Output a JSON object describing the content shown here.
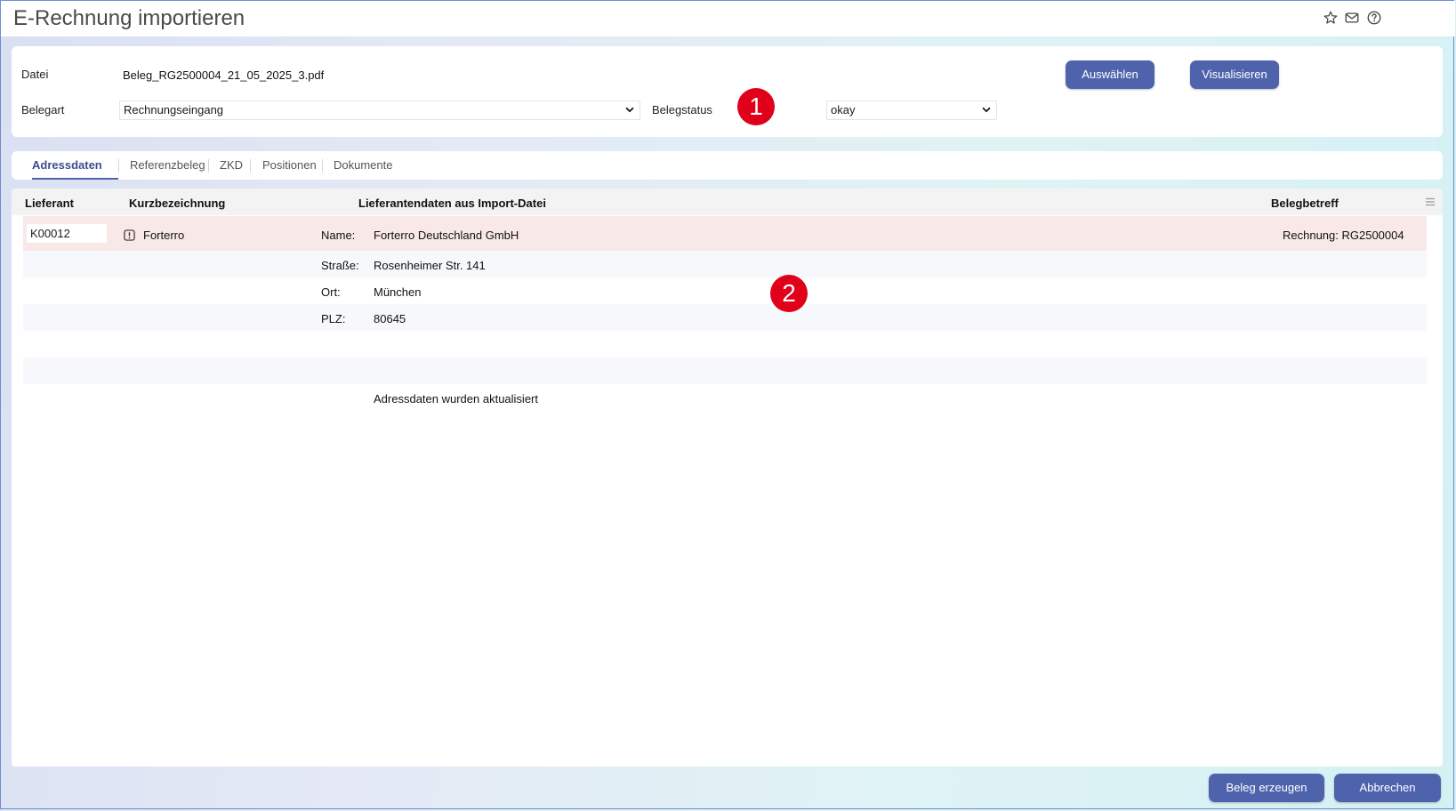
{
  "window": {
    "title": "E-Rechnung importieren",
    "icons": [
      "star-icon",
      "mail-icon",
      "help-icon"
    ]
  },
  "header": {
    "datei_label": "Datei",
    "datei_value": "Beleg_RG2500004_21_05_2025_3.pdf",
    "belegart_label": "Belegart",
    "belegart_value": "Rechnungseingang",
    "belegstatus_label": "Belegstatus",
    "belegstatus_value": "okay",
    "auswaehlen_label": "Auswählen",
    "visualisieren_label": "Visualisieren"
  },
  "markers": [
    "1",
    "2"
  ],
  "tabs": [
    {
      "label": "Adressdaten",
      "active": true
    },
    {
      "label": "Referenzbeleg",
      "active": false
    },
    {
      "label": "ZKD",
      "active": false
    },
    {
      "label": "Positionen",
      "active": false
    },
    {
      "label": "Dokumente",
      "active": false
    }
  ],
  "grid": {
    "columns": [
      "Lieferant",
      "Kurzbezeichnung",
      "Lieferantendaten aus Import-Datei",
      "Belegbetreff"
    ],
    "lieferant": "K00012",
    "kurzbezeichnung": "Forterro",
    "fields": [
      {
        "label": "Name:",
        "value": "Forterro Deutschland GmbH"
      },
      {
        "label": "Straße:",
        "value": "Rosenheimer Str. 141"
      },
      {
        "label": "Ort:",
        "value": "München"
      },
      {
        "label": "PLZ:",
        "value": "80645"
      }
    ],
    "belegbetreff": "Rechnung: RG2500004",
    "message": "Adressdaten wurden aktualisiert"
  },
  "footer": {
    "beleg_erzeugen_label": "Beleg erzeugen",
    "abbrechen_label": "Abbrechen"
  },
  "colors": {
    "accent": "#4f63ad",
    "marker": "#e0001a",
    "highlight_row": "#f8e9e8"
  }
}
